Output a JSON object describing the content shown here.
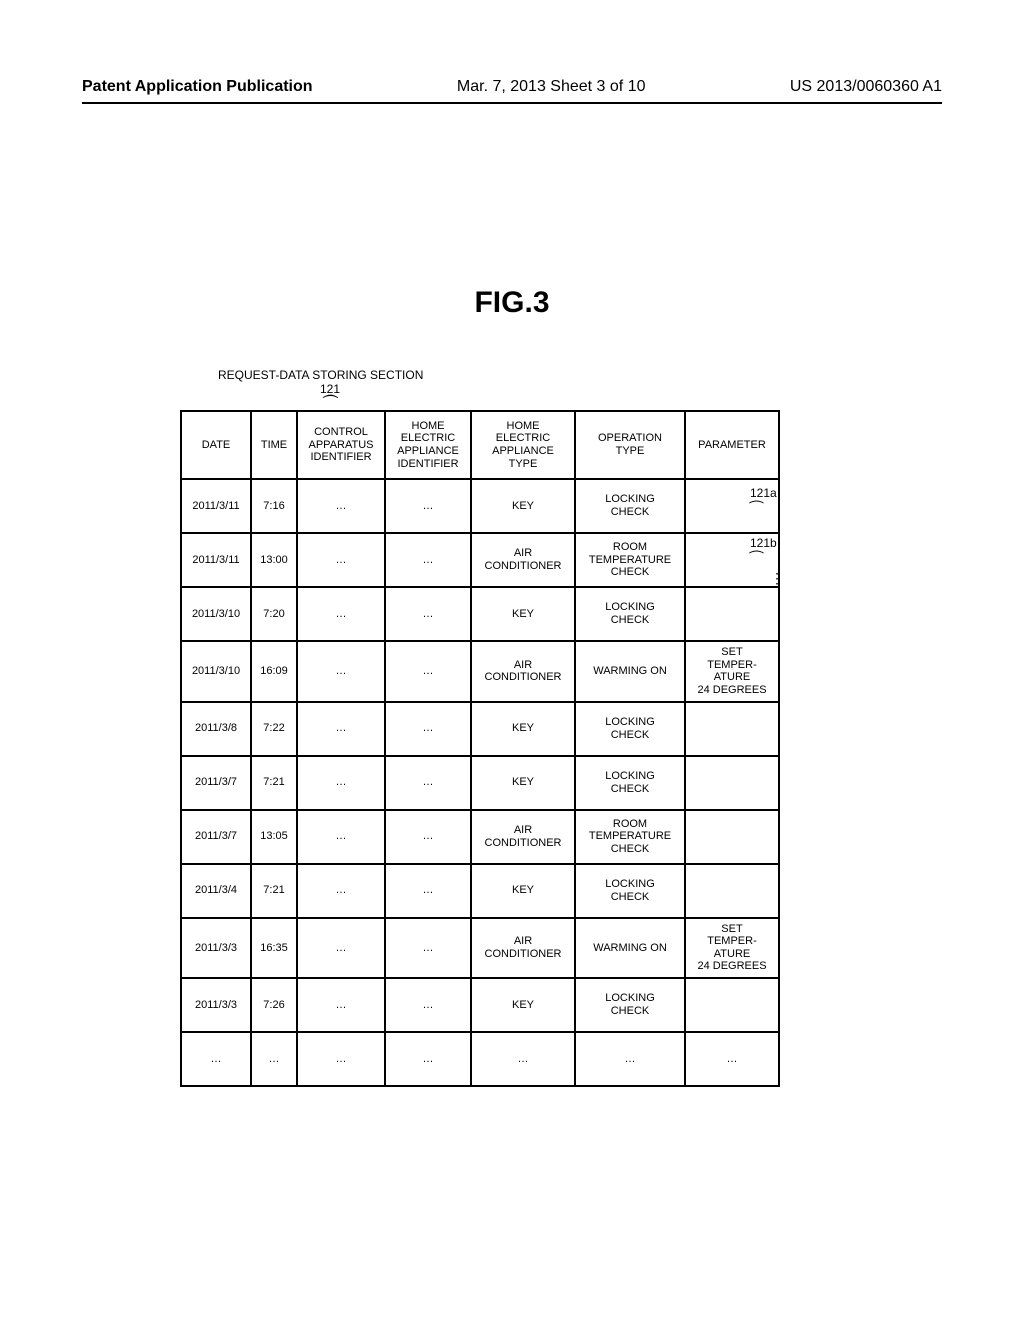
{
  "header": {
    "publication": "Patent Application Publication",
    "date_sheet": "Mar. 7, 2013  Sheet 3 of 10",
    "pubnum": "US 2013/0060360 A1"
  },
  "figure": {
    "title": "FIG.3",
    "section_label": "REQUEST-DATA STORING SECTION",
    "section_number": "121",
    "row_annotations": [
      "121a",
      "121b"
    ]
  },
  "chart_data": {
    "type": "table",
    "columns": [
      "DATE",
      "TIME",
      "CONTROL\nAPPARATUS\nIDENTIFIER",
      "HOME\nELECTRIC\nAPPLIANCE\nIDENTIFIER",
      "HOME\nELECTRIC\nAPPLIANCE\nTYPE",
      "OPERATION\nTYPE",
      "PARAMETER"
    ],
    "rows": [
      [
        "2011/3/11",
        "7:16",
        "…",
        "…",
        "KEY",
        "LOCKING\nCHECK",
        ""
      ],
      [
        "2011/3/11",
        "13:00",
        "…",
        "…",
        "AIR\nCONDITIONER",
        "ROOM\nTEMPERATURE\nCHECK",
        ""
      ],
      [
        "2011/3/10",
        "7:20",
        "…",
        "…",
        "KEY",
        "LOCKING\nCHECK",
        ""
      ],
      [
        "2011/3/10",
        "16:09",
        "…",
        "…",
        "AIR\nCONDITIONER",
        "WARMING ON",
        "SET\nTEMPER-\nATURE\n24 DEGREES"
      ],
      [
        "2011/3/8",
        "7:22",
        "…",
        "…",
        "KEY",
        "LOCKING\nCHECK",
        ""
      ],
      [
        "2011/3/7",
        "7:21",
        "…",
        "…",
        "KEY",
        "LOCKING\nCHECK",
        ""
      ],
      [
        "2011/3/7",
        "13:05",
        "…",
        "…",
        "AIR\nCONDITIONER",
        "ROOM\nTEMPERATURE\nCHECK",
        ""
      ],
      [
        "2011/3/4",
        "7:21",
        "…",
        "…",
        "KEY",
        "LOCKING\nCHECK",
        ""
      ],
      [
        "2011/3/3",
        "16:35",
        "…",
        "…",
        "AIR\nCONDITIONER",
        "WARMING ON",
        "SET\nTEMPER-\nATURE\n24 DEGREES"
      ],
      [
        "2011/3/3",
        "7:26",
        "…",
        "…",
        "KEY",
        "LOCKING\nCHECK",
        ""
      ],
      [
        "…",
        "…",
        "…",
        "…",
        "…",
        "…",
        "…"
      ]
    ]
  }
}
